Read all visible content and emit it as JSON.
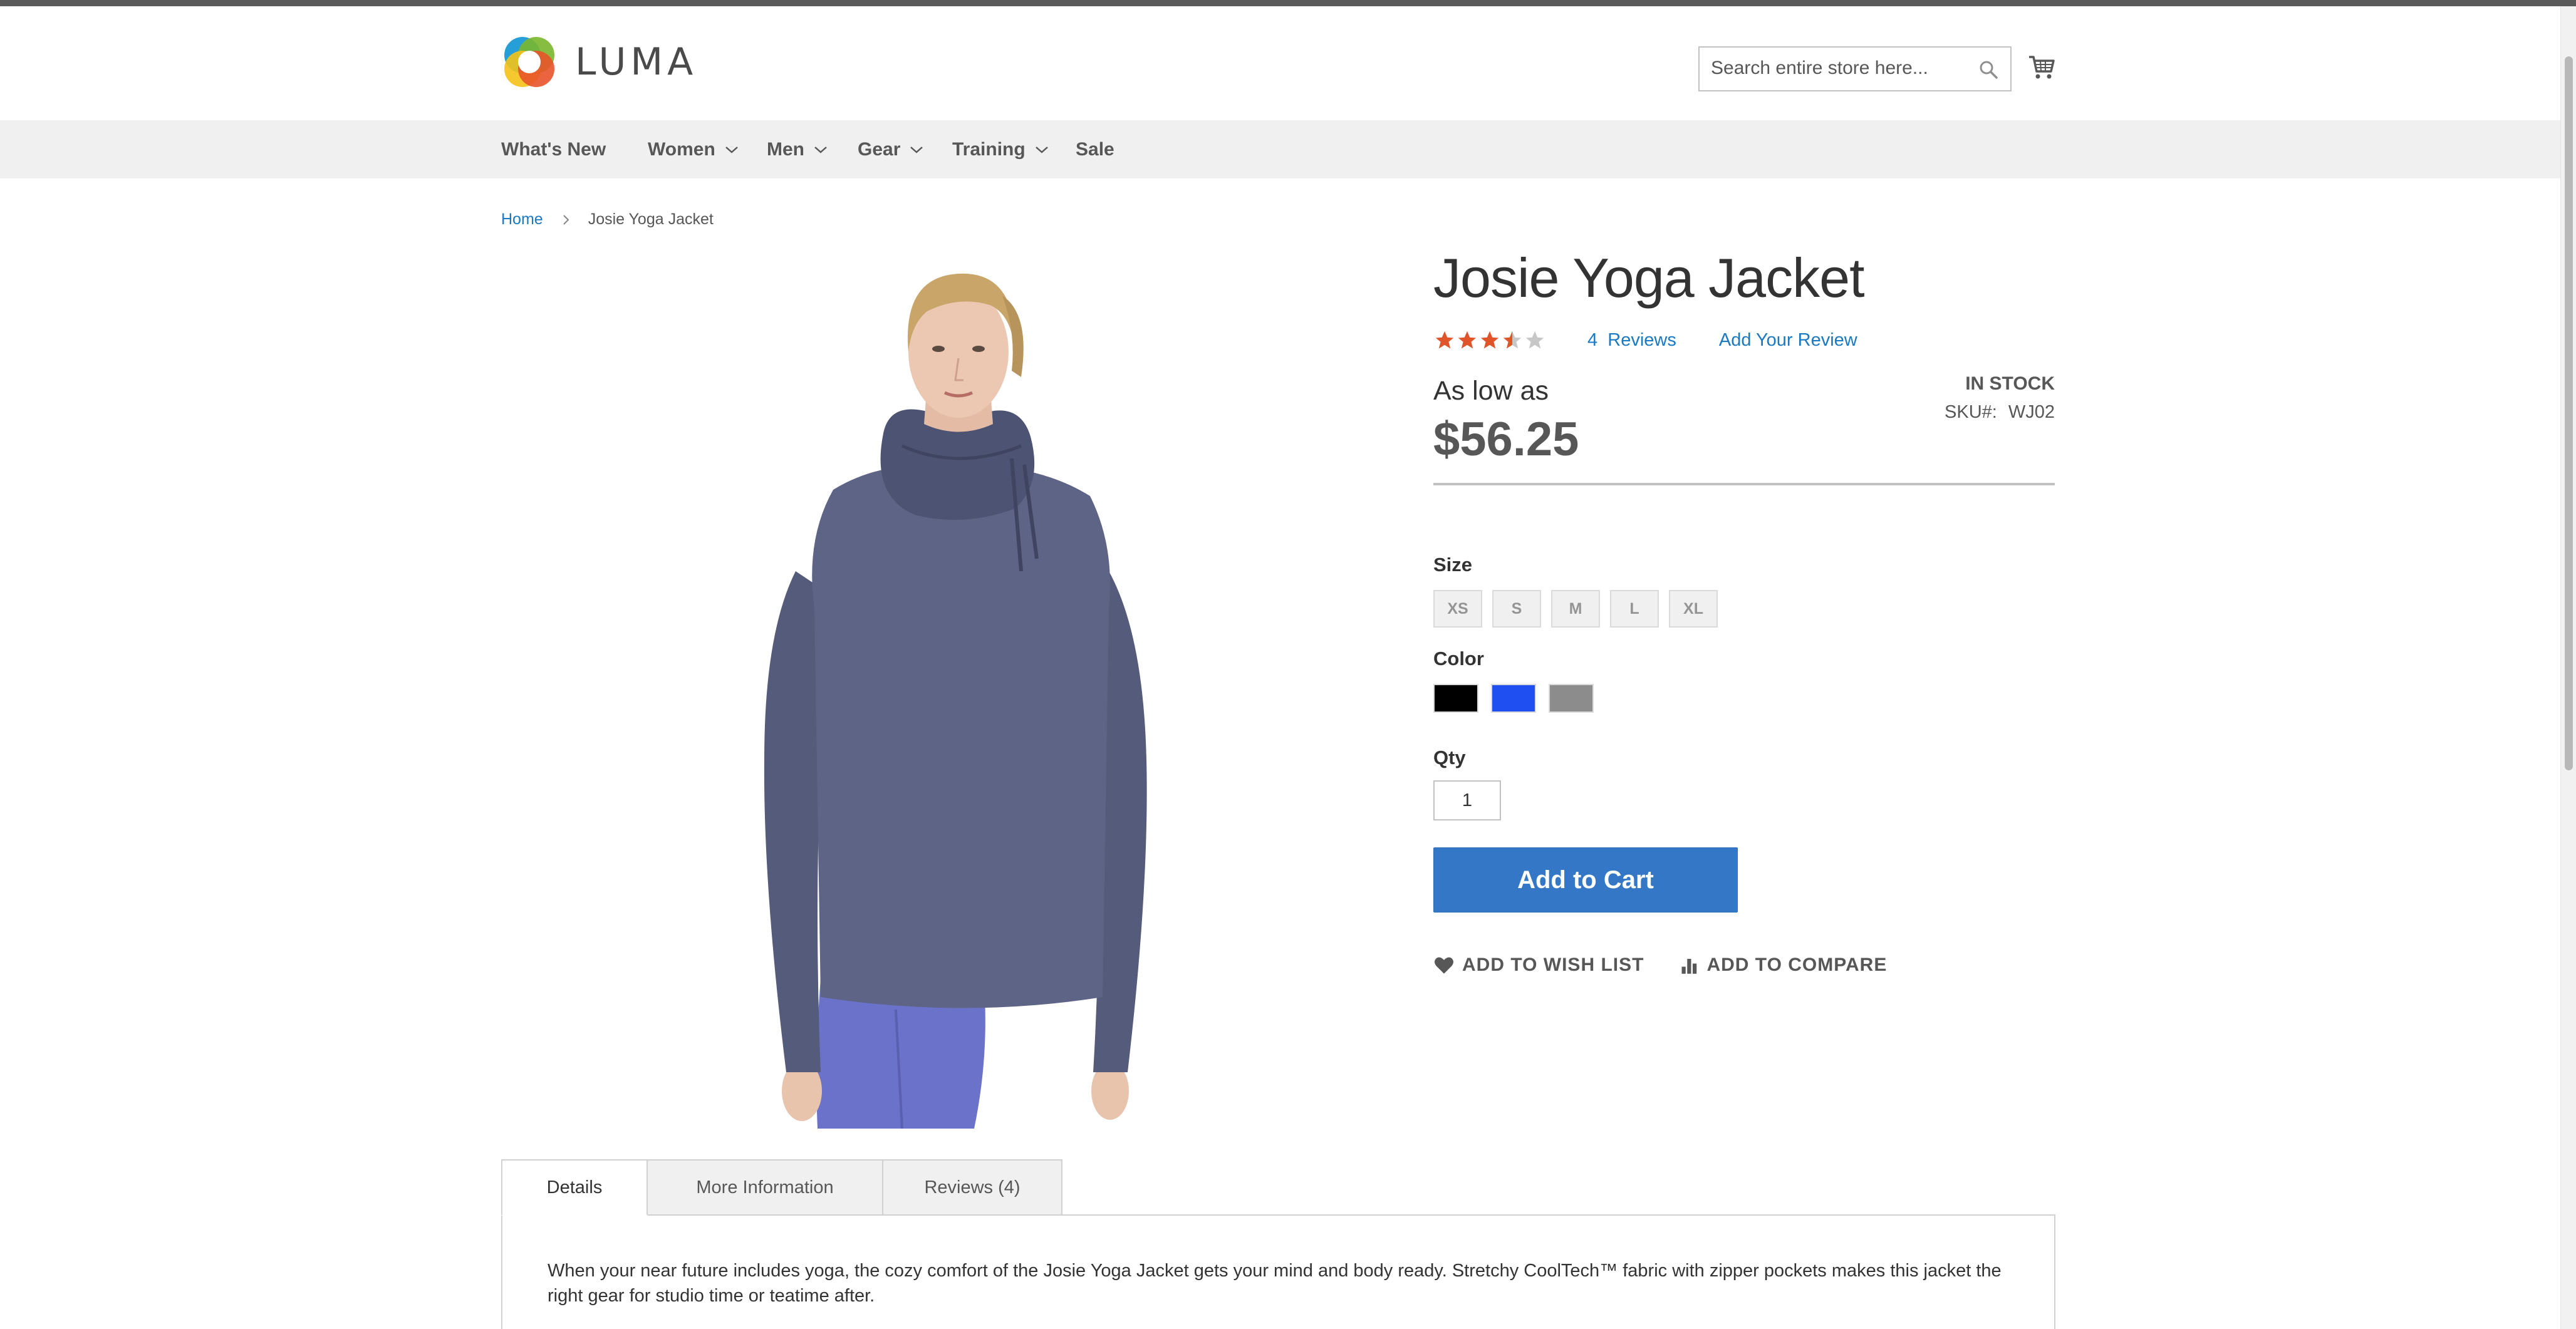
{
  "store": {
    "logo_text": "LUMA",
    "search_placeholder": "Search entire store here...",
    "icons": {
      "search": "search-icon",
      "cart": "cart-icon"
    }
  },
  "nav": {
    "items": [
      {
        "label": "What's New",
        "has_dropdown": false
      },
      {
        "label": "Women",
        "has_dropdown": true
      },
      {
        "label": "Men",
        "has_dropdown": true
      },
      {
        "label": "Gear",
        "has_dropdown": true
      },
      {
        "label": "Training",
        "has_dropdown": true
      },
      {
        "label": "Sale",
        "has_dropdown": false
      }
    ]
  },
  "breadcrumbs": {
    "home": "Home",
    "current": "Josie Yoga Jacket"
  },
  "product": {
    "title": "Josie Yoga Jacket",
    "rating": {
      "value": 3.5,
      "max": 5,
      "reviews_count": "4",
      "reviews_label": "Reviews"
    },
    "add_review": "Add Your Review",
    "price_label": "As low as",
    "price": "$56.25",
    "stock": "IN STOCK",
    "sku_label": "SKU#:",
    "sku": "WJ02",
    "size_label": "Size",
    "sizes": [
      "XS",
      "S",
      "M",
      "L",
      "XL"
    ],
    "color_label": "Color",
    "colors": [
      "#000000",
      "#1f4ff0",
      "#8c8c8c"
    ],
    "qty_label": "Qty",
    "qty_value": "1",
    "add_to_cart": "Add to Cart",
    "wishlist": "ADD TO WISH LIST",
    "compare": "ADD TO COMPARE"
  },
  "tabs": {
    "items": [
      "Details",
      "More Information",
      "Reviews (4)"
    ],
    "active": 0,
    "details_text": "When your near future includes yoga, the cozy comfort of the Josie Yoga Jacket gets your mind and body ready. Stretchy CoolTech™ fabric with zipper pockets makes this jacket the right gear for studio time or teatime after."
  },
  "colors": {
    "accent": "#1979c3",
    "button": "#3477c6",
    "star": "#e0542a"
  }
}
